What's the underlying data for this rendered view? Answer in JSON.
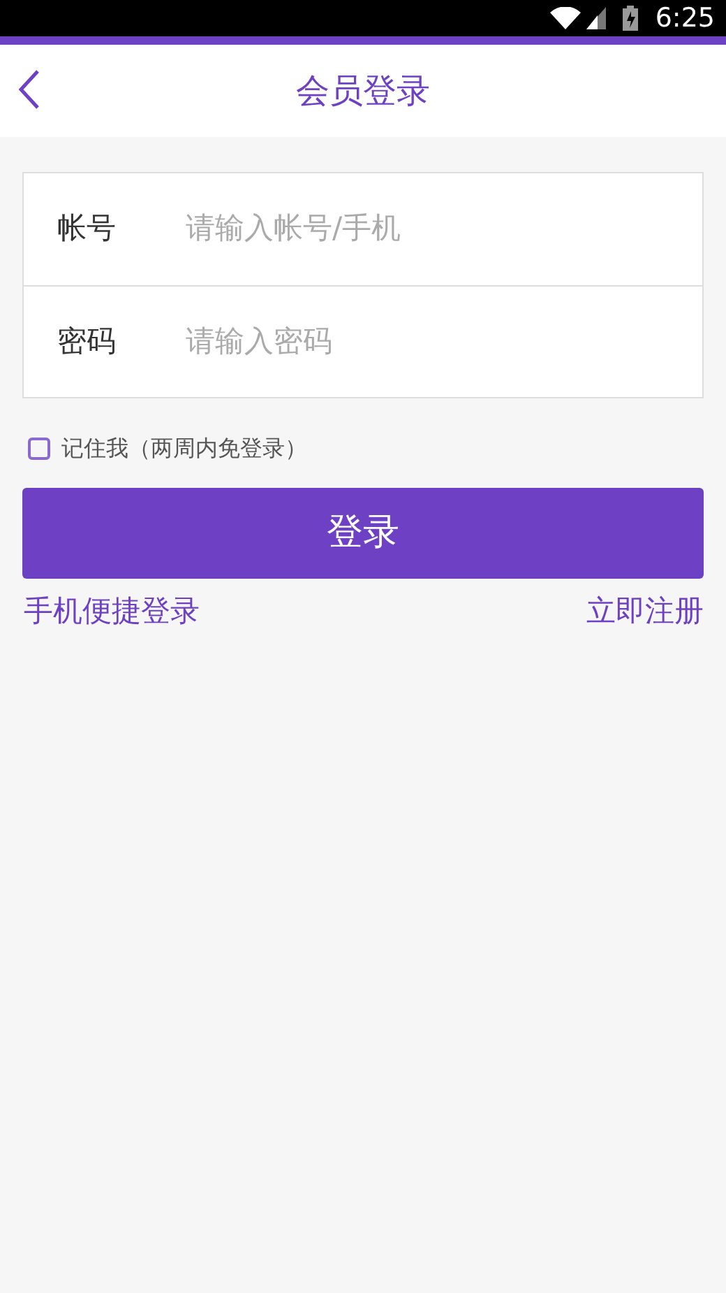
{
  "status_bar": {
    "time": "6:25"
  },
  "header": {
    "title": "会员登录"
  },
  "fields": [
    {
      "label": "帐号",
      "placeholder": "请输入帐号/手机"
    },
    {
      "label": "密码",
      "placeholder": "请输入密码"
    }
  ],
  "remember": {
    "label": "记住我（两周内免登录）",
    "checked": false
  },
  "login_button": "登录",
  "links": [
    "手机便捷登录",
    "立即注册"
  ]
}
